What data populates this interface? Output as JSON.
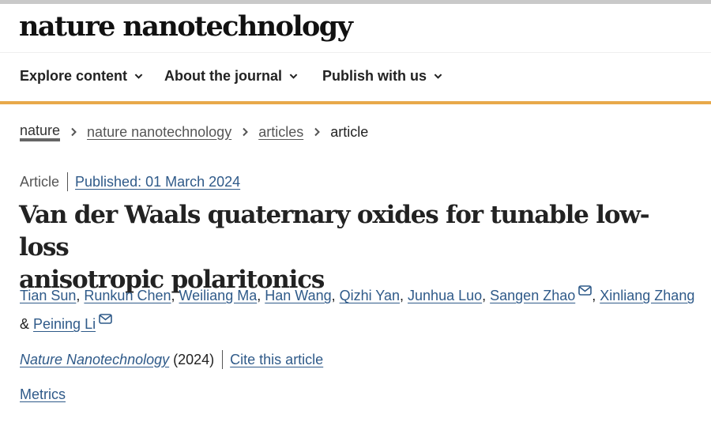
{
  "site": {
    "logo": "nature nanotechnology"
  },
  "nav": {
    "items": [
      {
        "label": "Explore content"
      },
      {
        "label": "About the journal"
      },
      {
        "label": "Publish with us"
      }
    ]
  },
  "breadcrumb": {
    "items": [
      "nature",
      "nature nanotechnology",
      "articles"
    ],
    "current": "article"
  },
  "article": {
    "type": "Article",
    "published": "Published: 01 March 2024",
    "title_line1": "Van der Waals quaternary oxides for tunable low-loss",
    "title_line2": "anisotropic polaritonics",
    "authors": [
      "Tian Sun",
      "Runkun Chen",
      "Weiliang Ma",
      "Han Wang",
      "Qizhi Yan",
      "Junhua Luo",
      "Sangen Zhao",
      "Xinliang Zhang",
      "Peining Li"
    ],
    "author_separator": ", ",
    "author_and": "& ",
    "journal": "Nature Nanotechnology",
    "year": "(2024)",
    "cite_label": "Cite this article",
    "metrics_label": "Metrics"
  },
  "colors": {
    "link": "#2f5a89",
    "accent_rule": "#e8a94a",
    "top_stripe": "#c9c9c9"
  },
  "icons": {
    "nav_chevron": "chevron-down-icon",
    "breadcrumb_sep": "chevron-right-icon",
    "corresponding": "envelope-icon"
  }
}
